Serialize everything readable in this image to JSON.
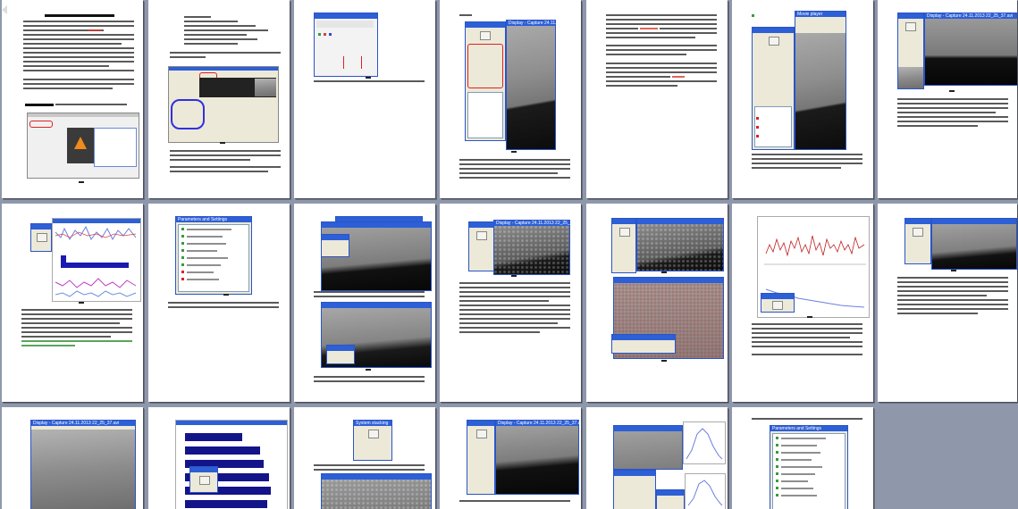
{
  "document": {
    "view": "multi-page thumbnail overview",
    "rows": 3,
    "columns": 7,
    "accent_window_title_color": "#2d5fd6",
    "highlight_color": "#e02020",
    "background_color": "#8f97ab"
  },
  "window_titles": {
    "display": "Display - Capture 24.11.2013 22_25_37.avi",
    "parameters": "Parameters and Settings",
    "stack": "System stacking",
    "movie": "Movie player"
  },
  "pages": [
    {
      "id": 1,
      "kind": "text-with-screenshot"
    },
    {
      "id": 2,
      "kind": "text-with-screenshot"
    },
    {
      "id": 3,
      "kind": "dialog-screenshot"
    },
    {
      "id": 4,
      "kind": "text-with-screenshot"
    },
    {
      "id": 5,
      "kind": "text"
    },
    {
      "id": 6,
      "kind": "text-with-screenshot"
    },
    {
      "id": 7,
      "kind": "text-with-screenshot"
    },
    {
      "id": 8,
      "kind": "text-with-chart"
    },
    {
      "id": 9,
      "kind": "text-with-tree"
    },
    {
      "id": 10,
      "kind": "text-with-screenshot"
    },
    {
      "id": 11,
      "kind": "text-with-screenshot"
    },
    {
      "id": 12,
      "kind": "text-with-screenshot"
    },
    {
      "id": 13,
      "kind": "text-with-chart"
    },
    {
      "id": 14,
      "kind": "text-with-screenshot"
    },
    {
      "id": 15,
      "kind": "screenshot"
    },
    {
      "id": 16,
      "kind": "bar-chart"
    },
    {
      "id": 17,
      "kind": "text-with-screenshot"
    },
    {
      "id": 18,
      "kind": "screenshot"
    },
    {
      "id": 19,
      "kind": "screenshot"
    },
    {
      "id": 20,
      "kind": "text-with-tree"
    },
    {
      "id": 21,
      "kind": "blank"
    }
  ]
}
